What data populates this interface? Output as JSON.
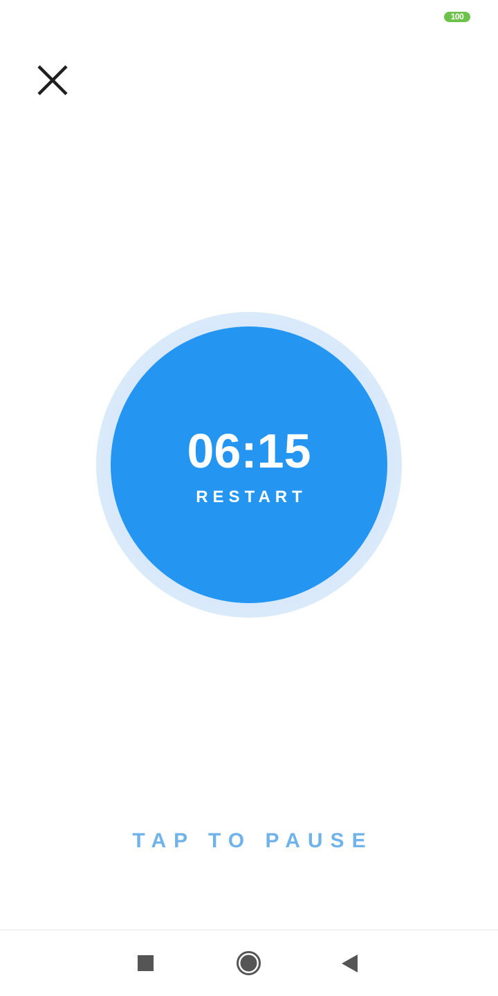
{
  "status_bar": {
    "battery_level": "100",
    "battery_color": "#6cc24a"
  },
  "header": {
    "close_icon": "close-icon"
  },
  "timer": {
    "time": "06:15",
    "restart_label": "RESTART",
    "accent_color": "#2496f2"
  },
  "footer": {
    "tap_label": "TAP TO PAUSE",
    "tap_color": "#6fb3ea"
  },
  "nav_bar": {
    "recents_icon": "square-icon",
    "home_icon": "circle-icon",
    "back_icon": "triangle-back-icon"
  }
}
